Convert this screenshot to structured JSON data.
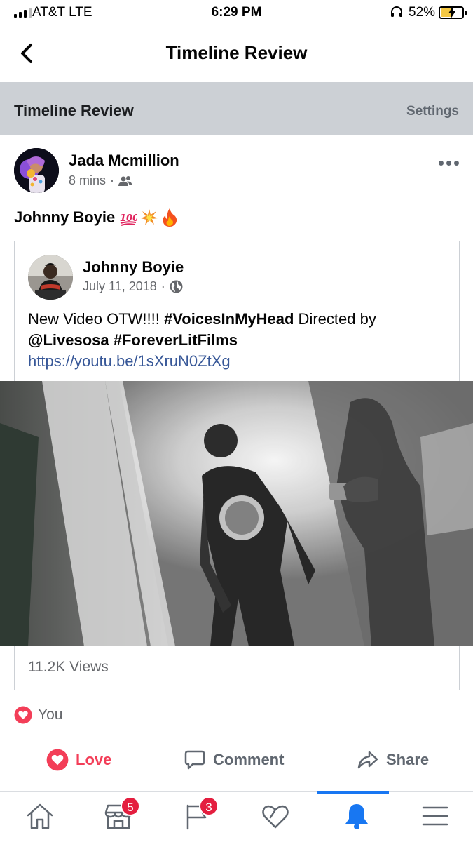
{
  "status_bar": {
    "carrier": "AT&T  LTE",
    "time": "6:29 PM",
    "battery_percent": "52%",
    "battery_level": 0.52
  },
  "nav": {
    "title": "Timeline Review",
    "back_icon": "chevron-left-icon"
  },
  "section": {
    "title": "Timeline Review",
    "settings_label": "Settings"
  },
  "post": {
    "author": "Jada Mcmillion",
    "time": "8 mins",
    "separator": "·",
    "audience_icon": "friends-icon",
    "text": "Johnny Boyie",
    "emojis": [
      "hundred-points-icon",
      "collision-icon",
      "fire-icon"
    ]
  },
  "shared": {
    "author": "Johnny Boyie",
    "date": "July 11, 2018",
    "separator": "·",
    "audience_icon": "globe-icon",
    "text_prefix": "New Video OTW!!!! ",
    "hashtag1": "#VoicesInMyHead",
    "text_middle": " Directed by ",
    "mention": "@Livesosa",
    "hashtag2": "#ForeverLitFilms",
    "link": "https://youtu.be/1sXruN0ZtXg",
    "views": "11.2K Views"
  },
  "reactions": {
    "summary": "You",
    "icon": "love-reaction-icon"
  },
  "actions": {
    "love_label": "Love",
    "comment_label": "Comment",
    "share_label": "Share"
  },
  "tabbar": {
    "tabs": [
      {
        "icon": "home-icon"
      },
      {
        "icon": "marketplace-icon",
        "badge": "5"
      },
      {
        "icon": "pages-flag-icon",
        "badge": "3"
      },
      {
        "icon": "dating-heart-icon"
      },
      {
        "icon": "notifications-bell-icon",
        "active": true
      },
      {
        "icon": "menu-icon"
      }
    ]
  },
  "colors": {
    "accent": "#1877f2",
    "love": "#f33e58",
    "link": "#385898",
    "badge": "#e41e3f",
    "section_bg": "#ccd0d5"
  }
}
